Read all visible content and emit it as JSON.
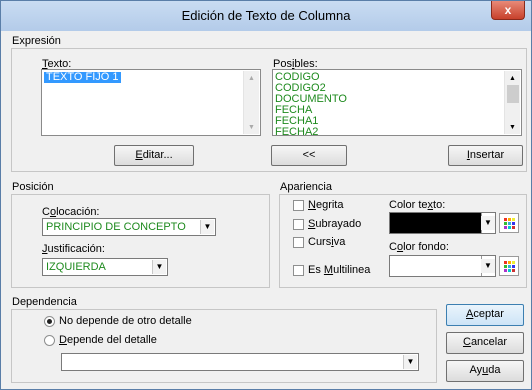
{
  "window": {
    "title": "Edición de Texto de Columna",
    "close": "x"
  },
  "expresion": {
    "group_label": "Expresión",
    "texto_label_u": "T",
    "texto_label_rest": "exto:",
    "texto_value": "TEXTO FIJO 1",
    "posibles_label_pre": "Pos",
    "posibles_label_u": "i",
    "posibles_label_post": "bles:",
    "posibles_items": [
      "CODIGO",
      "CODIGO2",
      "DOCUMENTO",
      "FECHA",
      "FECHA1",
      "FECHA2"
    ],
    "editar_u": "E",
    "editar_rest": "ditar...",
    "move_label": "<<",
    "insertar_u": "I",
    "insertar_rest": "nsertar"
  },
  "posicion": {
    "group_label": "Posición",
    "colocacion_pre": "C",
    "colocacion_u": "o",
    "colocacion_post": "locación:",
    "colocacion_value": "PRINCIPIO DE CONCEPTO",
    "justificacion_u": "J",
    "justificacion_rest": "ustificación:",
    "justificacion_value": "IZQUIERDA"
  },
  "apariencia": {
    "group_label": "Apariencia",
    "negrita_u": "N",
    "negrita_rest": "egrita",
    "subrayado_u": "S",
    "subrayado_rest": "ubrayado",
    "cursiva_pre": "Curs",
    "cursiva_u": "i",
    "cursiva_post": "va",
    "multilinea_pre": "Es ",
    "multilinea_u": "M",
    "multilinea_post": "ultilinea",
    "color_texto_pre": "Color te",
    "color_texto_u": "x",
    "color_texto_post": "to:",
    "color_texto_value": "#000000",
    "color_fondo_pre": "C",
    "color_fondo_u": "o",
    "color_fondo_post": "lor fondo:",
    "color_fondo_value": "#ffffff"
  },
  "dependencia": {
    "group_label": "Dependencia",
    "opt1": "No depende de otro detalle",
    "opt2_u": "D",
    "opt2_rest": "epende del detalle"
  },
  "buttons": {
    "aceptar_u": "A",
    "aceptar_rest": "ceptar",
    "cancelar_u": "C",
    "cancelar_rest": "ancelar",
    "ayuda_pre": "Ay",
    "ayuda_u": "u",
    "ayuda_post": "da"
  },
  "icons": {
    "arrow_up": "▲",
    "arrow_down": "▼"
  },
  "colors": {
    "list_text": "#1e8a1e",
    "selection": "#3399ff"
  }
}
